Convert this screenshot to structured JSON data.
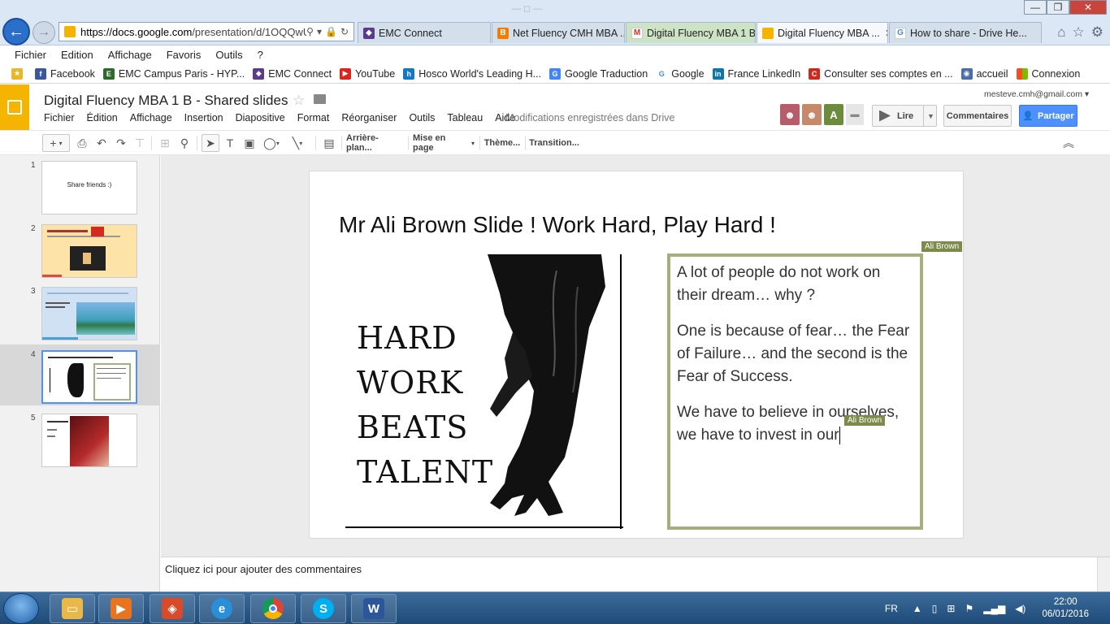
{
  "browser": {
    "address_url_prefix": "https://docs.google.com",
    "address_url_rest": "/presentation/d/1OQQwU",
    "tabs": [
      {
        "label": "EMC Connect"
      },
      {
        "label": "Net Fluency CMH MBA ..."
      },
      {
        "label": "Digital Fluency MBA 1 B..."
      },
      {
        "label": "Digital Fluency MBA ..."
      },
      {
        "label": "How to share - Drive He..."
      }
    ],
    "menu": [
      "Fichier",
      "Edition",
      "Affichage",
      "Favoris",
      "Outils",
      "?"
    ],
    "bookmarks": [
      {
        "label": "Facebook",
        "color": "#3b5998",
        "glyph": "f"
      },
      {
        "label": "EMC Campus Paris - HYP...",
        "color": "#2d6a2d",
        "glyph": "E"
      },
      {
        "label": "EMC Connect",
        "color": "#5b3b8a",
        "glyph": "E"
      },
      {
        "label": "YouTube",
        "color": "#d9251d",
        "glyph": "▶"
      },
      {
        "label": "Hosco  World's Leading H...",
        "color": "#1479c4",
        "glyph": "h"
      },
      {
        "label": "Google Traduction",
        "color": "#4285f4",
        "glyph": "G"
      },
      {
        "label": "Google",
        "color": "#4285f4",
        "glyph": "G"
      },
      {
        "label": "France  LinkedIn",
        "color": "#0e76a8",
        "glyph": "in"
      },
      {
        "label": "Consulter ses comptes en ...",
        "color": "#d0281f",
        "glyph": "C"
      },
      {
        "label": "accueil",
        "color": "#4a6ea8",
        "glyph": "a"
      },
      {
        "label": "Connexion",
        "color": "#e74c3c",
        "glyph": "■"
      }
    ]
  },
  "app": {
    "doc_title": "Digital Fluency MBA 1 B - Shared slides",
    "menu": [
      "Fichier",
      "Édition",
      "Affichage",
      "Insertion",
      "Diapositive",
      "Format",
      "Réorganiser",
      "Outils",
      "Tableau",
      "Aide"
    ],
    "save_status": "Modifications enregistrées dans Drive",
    "account_email": "mesteve.cmh@gmail.com",
    "avatar_letter": "A",
    "present_label": "Lire",
    "comments_label": "Commentaires",
    "share_label": "Partager"
  },
  "toolbar": {
    "background_label": "Arrière-plan...",
    "layout_label": "Mise en page",
    "theme_label": "Thème...",
    "transition_label": "Transition..."
  },
  "filmstrip": [
    {
      "number": "1",
      "text": "Share friends :)"
    },
    {
      "number": "2",
      "text": ""
    },
    {
      "number": "3",
      "text": ""
    },
    {
      "number": "4",
      "text": ""
    },
    {
      "number": "5",
      "text": ""
    }
  ],
  "slide": {
    "title": "Mr Ali Brown Slide ! Work Hard, Play Hard !",
    "image_lines": [
      "HARD",
      "WORK",
      "BEATS",
      "TALENT"
    ],
    "paragraphs": [
      "A lot of people do not work on their dream… why ?",
      "One is because of fear… the Fear of Failure… and the second is the Fear of Success.",
      "We have to believe in ourselves, we have to invest in our"
    ],
    "collaborator_name": "Ali Brown"
  },
  "notes_placeholder": "Cliquez ici pour ajouter des commentaires",
  "taskbar": {
    "language": "FR",
    "time": "22:00",
    "date": "06/01/2016"
  },
  "colors": {
    "accent": "#f4b400",
    "share_blue": "#4d90fe",
    "textbox_border": "#a7ad7d",
    "collab_flag": "#7c8a4a"
  }
}
